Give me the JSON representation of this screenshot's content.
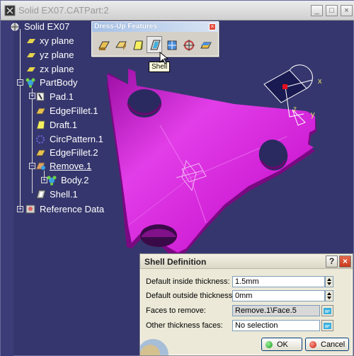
{
  "window": {
    "title": "Solid EX07.CATPart:2",
    "minimize": "_",
    "maximize": "□",
    "close": "×"
  },
  "tree": {
    "root": "Solid EX07",
    "items": [
      {
        "label": "xy plane",
        "icon": "plane-icon"
      },
      {
        "label": "yz plane",
        "icon": "plane-icon"
      },
      {
        "label": "zx plane",
        "icon": "plane-icon"
      },
      {
        "label": "PartBody",
        "icon": "body-icon"
      },
      {
        "label": "Pad.1",
        "icon": "pad-icon"
      },
      {
        "label": "EdgeFillet.1",
        "icon": "fillet-icon"
      },
      {
        "label": "Draft.1",
        "icon": "draft-icon"
      },
      {
        "label": "CircPattern.1",
        "icon": "pattern-icon"
      },
      {
        "label": "EdgeFillet.2",
        "icon": "fillet-icon"
      },
      {
        "label": "Remove.1",
        "icon": "remove-icon"
      },
      {
        "label": "Body.2",
        "icon": "body-icon"
      },
      {
        "label": "Shell.1",
        "icon": "shell-icon"
      },
      {
        "label": "Reference Data",
        "icon": "reference-icon"
      }
    ]
  },
  "toolbar": {
    "title": "Dress-Up Features",
    "close": "×",
    "tooltip": "Shell"
  },
  "compass": {
    "x_label": "x",
    "y_label": "y",
    "z_label": "z"
  },
  "dialog": {
    "title": "Shell Definition",
    "help": "?",
    "close": "×",
    "inside_label": "Default inside thickness:",
    "inside_value": "1.5mm",
    "outside_label": "Default outside thickness:",
    "outside_value": "0mm",
    "faces_label": "Faces to remove:",
    "faces_value": "Remove.1\\Face.5",
    "other_label": "Other thickness faces:",
    "other_value": "No selection",
    "ok": "OK",
    "cancel": "Cancel"
  },
  "colors": {
    "background": "#36366e",
    "part": "#d31ad8",
    "tree_text": "#ffffff"
  }
}
